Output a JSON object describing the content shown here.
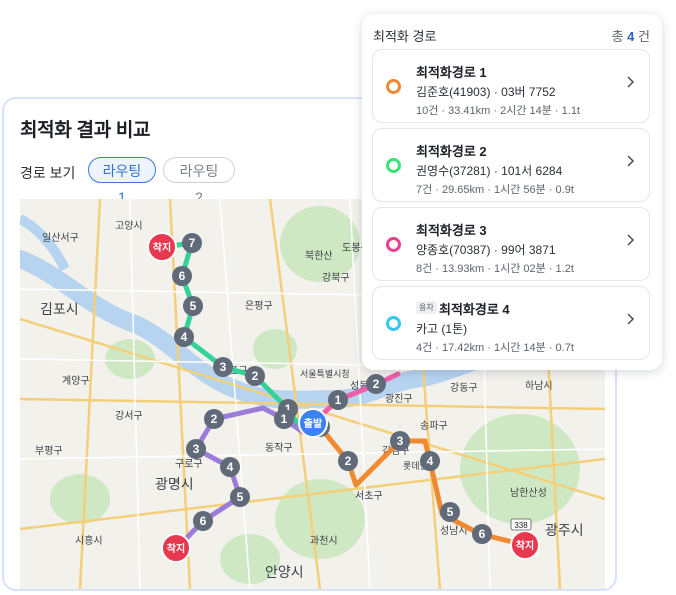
{
  "card": {
    "title": "최적화 결과 비교",
    "route_view_label": "경로 보기",
    "tabs": [
      {
        "label": "라우팅1",
        "active": true
      },
      {
        "label": "라우팅2",
        "active": false
      }
    ]
  },
  "map": {
    "labels": {
      "gimpo": "김포시",
      "gwangmyeong": "광명시",
      "anyang": "안양시",
      "gwangju": "광주시",
      "gangseo": "강서구",
      "guro": "구로구",
      "gangnam": "강남구",
      "seocho": "서초구",
      "dongjak": "동작구",
      "eunpyeong": "은평구",
      "mapo": "마포구",
      "gangbuk": "강북구",
      "dobong": "도봉구",
      "gangdong": "강동구",
      "songpa": "송파구",
      "gwangjin": "광진구",
      "seongdong": "성동구",
      "hanam": "하남시",
      "goyang": "고양시",
      "bupyeong": "부평구",
      "siheung": "시흥시",
      "gwacheon": "과천시",
      "seongnam": "성남시",
      "bukhansan": "북한산",
      "namhansanseong": "남한산성",
      "lotte": "롯데월드",
      "ilsan": "일산서구",
      "seoul_station": "서울특별시청",
      "gyeyang": "계양구"
    },
    "start_label": "출발",
    "end_label": "착지",
    "highway_338": "338"
  },
  "panel": {
    "title": "최적화 경로",
    "total_prefix": "총",
    "total_count": "4",
    "total_suffix": "건",
    "items": [
      {
        "title": "최적화경로 1",
        "driver": "김준호(41903) · 03버 7752",
        "stats": "10건 · 33.41km · 2시간 14분 · 1.1t",
        "color": "#f08a32",
        "badge": ""
      },
      {
        "title": "최적화경로 2",
        "driver": "권영수(37281) · 101서 6284",
        "stats": "7건 · 29.65km · 1시간 56분 · 0.9t",
        "color": "#3ee07a",
        "badge": ""
      },
      {
        "title": "최적화경로 3",
        "driver": "양종호(70387) · 99어 3871",
        "stats": "8건 · 13.93km · 1시간 02분 · 1.2t",
        "color": "#e83f8f",
        "badge": ""
      },
      {
        "title": "최적화경로 4",
        "driver": "카고 (1톤)",
        "stats": "4건 · 17.42km · 1시간 14분 · 0.7t",
        "color": "#35c6ee",
        "badge": "용차"
      }
    ]
  },
  "colors": {
    "route_green": "#34d19a",
    "route_purple": "#9b7cd8",
    "route_orange": "#f08a32",
    "route_pink": "#ef5ea8",
    "start_marker": "#3b82f6",
    "end_marker": "#e8384f",
    "stop_marker": "#606a78"
  }
}
